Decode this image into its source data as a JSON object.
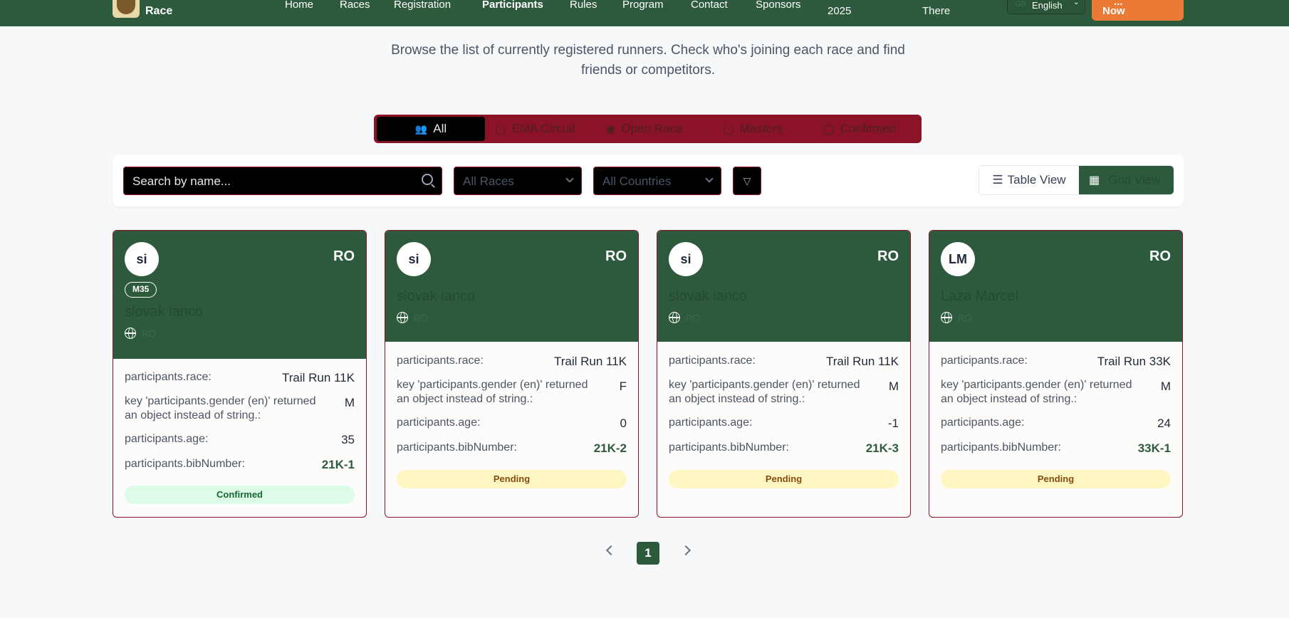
{
  "header": {
    "logo_text": "Race",
    "nav": [
      "Home",
      "Races",
      "Registration",
      "Participants",
      "Rules",
      "Program",
      "Contact",
      "Sponsors"
    ],
    "nav_year": "2025",
    "nav_there": "There",
    "language": "English",
    "language_ghost": "GB",
    "cta_line1": "...",
    "cta_line2": "Now"
  },
  "intro": "Browse the list of currently registered runners. Check who's joining each race and find friends or competitors.",
  "tabs": [
    "All",
    "EMA Circuit",
    "Open Race",
    "Masters",
    "Confirmed"
  ],
  "filters": {
    "search_placeholder": "Search by name...",
    "races": "All Races",
    "countries": "All Countries"
  },
  "views": {
    "table": "Table View",
    "grid": "Grid View"
  },
  "labels": {
    "race": "participants.race:",
    "gender": "key 'participants.gender (en)' returned an object instead of string.:",
    "age": "participants.age:",
    "bib": "participants.bibNumber:"
  },
  "participants": [
    {
      "initials": "si",
      "country": "RO",
      "category": "M35",
      "name": "slovak ianco",
      "country_code": "RO",
      "race": "Trail Run 11K",
      "gender": "M",
      "age": "35",
      "bib": "21K-1",
      "status": "Confirmed"
    },
    {
      "initials": "si",
      "country": "RO",
      "name": "slovak ianco",
      "country_code": "RO",
      "race": "Trail Run 11K",
      "gender": "F",
      "age": "0",
      "bib": "21K-2",
      "status": "Pending"
    },
    {
      "initials": "si",
      "country": "RO",
      "name": "slovak ianco",
      "country_code": "RO",
      "race": "Trail Run 11K",
      "gender": "M",
      "age": "-1",
      "bib": "21K-3",
      "status": "Pending"
    },
    {
      "initials": "LM",
      "country": "RO",
      "name": "Laza Marcel",
      "country_code": "RO",
      "race": "Trail Run 33K",
      "gender": "M",
      "age": "24",
      "bib": "33K-1",
      "status": "Pending"
    }
  ],
  "pagination": {
    "current": "1"
  },
  "colors": {
    "brand_green": "#2d5a3d",
    "accent_red": "#8b1327",
    "cta_orange": "#ea7a35"
  }
}
